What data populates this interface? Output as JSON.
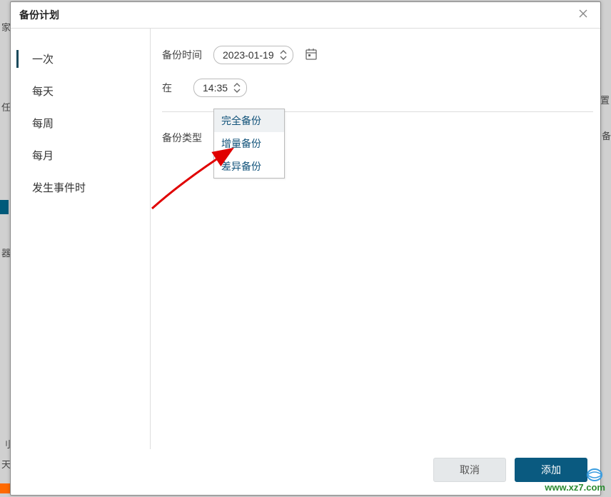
{
  "dialog": {
    "title": "备份计划"
  },
  "sidebar": {
    "items": [
      {
        "label": "一次",
        "active": true
      },
      {
        "label": "每天",
        "active": false
      },
      {
        "label": "每周",
        "active": false
      },
      {
        "label": "每月",
        "active": false
      },
      {
        "label": "发生事件时",
        "active": false
      }
    ]
  },
  "form": {
    "backup_time_label": "备份时间",
    "backup_time_value": "2023-01-19",
    "at_label": "在",
    "at_value": "14:35",
    "backup_type_label": "备份类型",
    "backup_type_value": "完全备份",
    "backup_type_options": [
      "完全备份",
      "增量备份",
      "差异备份"
    ]
  },
  "footer": {
    "cancel": "取消",
    "add": "添加"
  },
  "background": {
    "char1": "家",
    "char2": "任",
    "char3": "器",
    "char4": "刂",
    "char5": "天",
    "char6": "置",
    "char7": "刂备"
  },
  "watermark": {
    "url": "www.xz7.com"
  }
}
